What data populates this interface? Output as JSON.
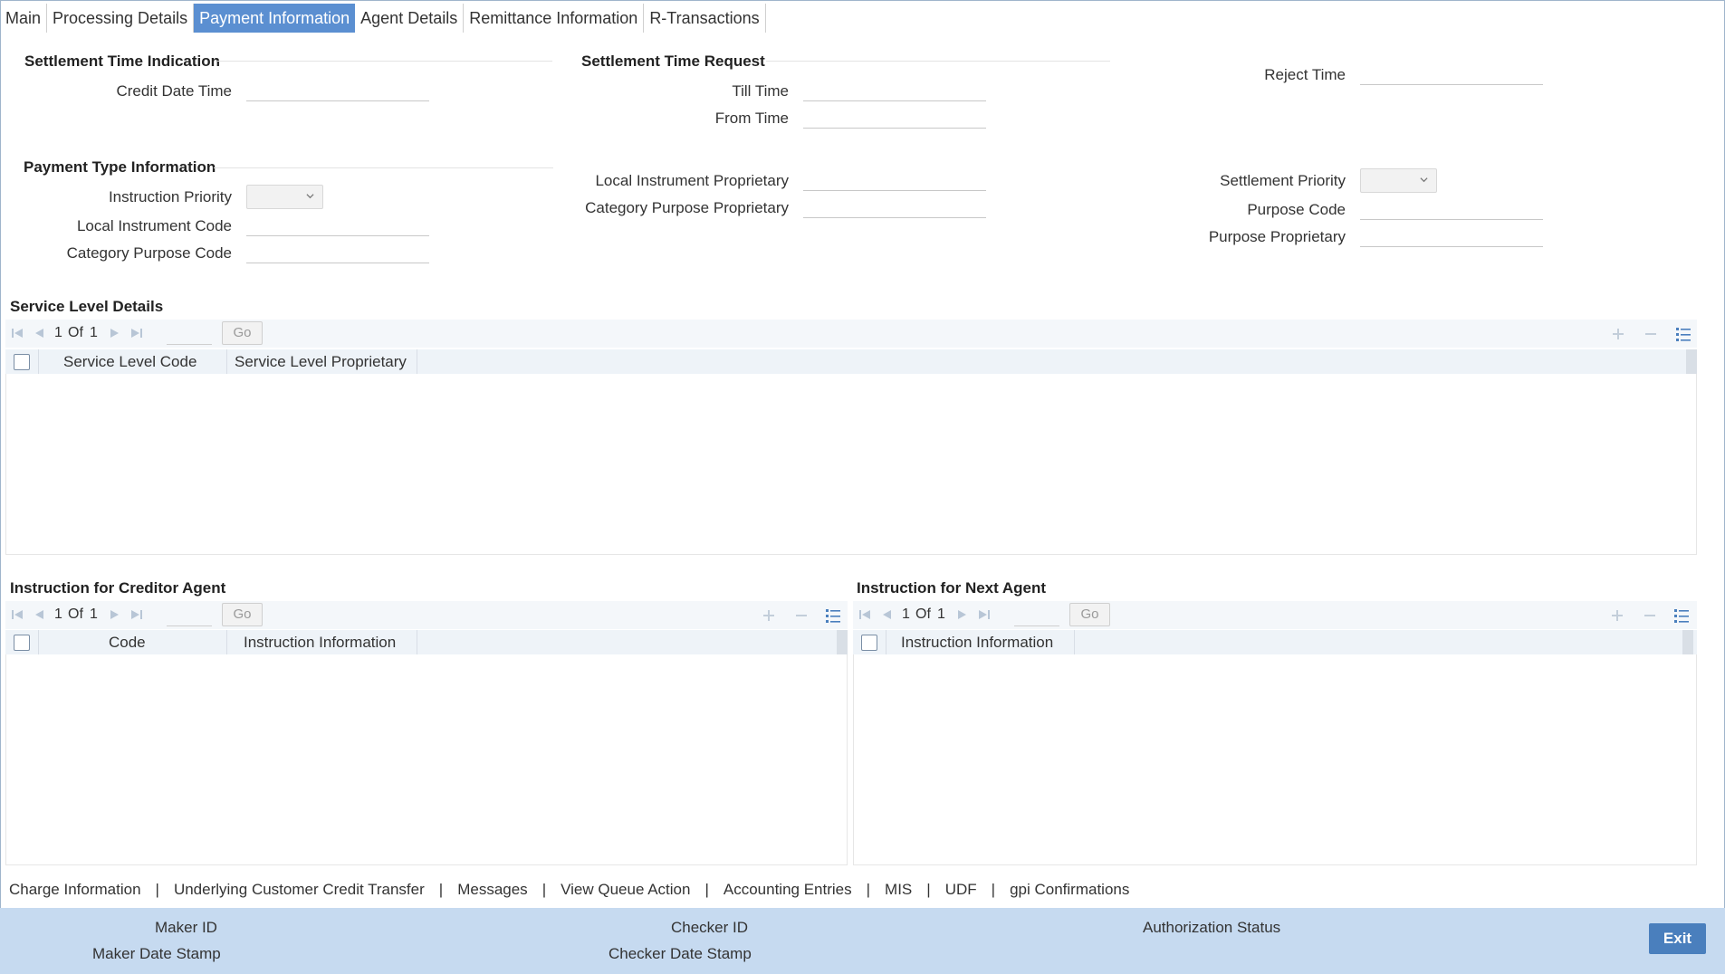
{
  "tabs": [
    {
      "label": "Main",
      "active": false
    },
    {
      "label": "Processing Details",
      "active": false
    },
    {
      "label": "Payment Information",
      "active": true
    },
    {
      "label": "Agent Details",
      "active": false
    },
    {
      "label": "Remittance Information",
      "active": false
    },
    {
      "label": "R-Transactions",
      "active": false
    }
  ],
  "settlement_time_indication": {
    "title": "Settlement Time Indication",
    "credit_date_time_label": "Credit Date Time",
    "credit_date_time_value": ""
  },
  "settlement_time_request": {
    "title": "Settlement Time Request",
    "till_time_label": "Till Time",
    "till_time_value": "",
    "from_time_label": "From Time",
    "from_time_value": "",
    "reject_time_label": "Reject Time",
    "reject_time_value": ""
  },
  "payment_type_information": {
    "title": "Payment Type Information",
    "instruction_priority_label": "Instruction Priority",
    "instruction_priority_value": "",
    "local_instrument_code_label": "Local Instrument Code",
    "local_instrument_code_value": "",
    "category_purpose_code_label": "Category Purpose Code",
    "category_purpose_code_value": "",
    "local_instrument_proprietary_label": "Local Instrument Proprietary",
    "local_instrument_proprietary_value": "",
    "category_purpose_proprietary_label": "Category Purpose Proprietary",
    "category_purpose_proprietary_value": "",
    "settlement_priority_label": "Settlement Priority",
    "settlement_priority_value": "",
    "purpose_code_label": "Purpose Code",
    "purpose_code_value": "",
    "purpose_proprietary_label": "Purpose Proprietary",
    "purpose_proprietary_value": ""
  },
  "service_level_details": {
    "title": "Service Level Details",
    "page_current": "1",
    "page_of": "Of",
    "page_total": "1",
    "go_label": "Go",
    "columns": [
      "Service Level Code",
      "Service Level Proprietary"
    ],
    "rows": []
  },
  "creditor_agent": {
    "title": "Instruction for Creditor Agent",
    "page_current": "1",
    "page_of": "Of",
    "page_total": "1",
    "go_label": "Go",
    "columns": [
      "Code",
      "Instruction Information"
    ],
    "rows": []
  },
  "next_agent": {
    "title": "Instruction for Next Agent",
    "page_current": "1",
    "page_of": "Of",
    "page_total": "1",
    "go_label": "Go",
    "columns": [
      "Instruction Information"
    ],
    "rows": []
  },
  "footer_links": [
    "Charge Information",
    "Underlying Customer Credit Transfer",
    "Messages",
    "View Queue Action",
    "Accounting Entries",
    "MIS",
    "UDF",
    "gpi Confirmations"
  ],
  "footer_separator": "|",
  "audit": {
    "maker_id_label": "Maker ID",
    "maker_date_stamp_label": "Maker Date Stamp",
    "checker_id_label": "Checker ID",
    "checker_date_stamp_label": "Checker Date Stamp",
    "authorization_status_label": "Authorization Status"
  },
  "exit_label": "Exit",
  "colors": {
    "active_tab": "#5b8fd1",
    "footer_bar": "#c6daf0",
    "exit_button": "#4a7fbd",
    "grid_header": "#eef3f8"
  }
}
